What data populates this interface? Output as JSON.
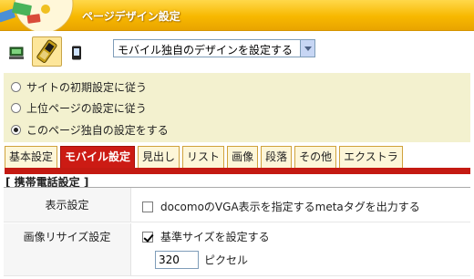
{
  "header": {
    "title": "ページデザイン設定"
  },
  "device_bar": {
    "icons": [
      "pc-icon",
      "mobile-device-icon",
      "smartphone-icon"
    ],
    "selected_device": "mobile",
    "design_select": {
      "value": "モバイル独自のデザインを設定する"
    }
  },
  "inherit_options": [
    {
      "label": "サイトの初期設定に従う",
      "checked": false
    },
    {
      "label": "上位ページの設定に従う",
      "checked": false
    },
    {
      "label": "このページ独自の設定をする",
      "checked": true
    }
  ],
  "tabs": [
    {
      "label": "基本設定",
      "active": false
    },
    {
      "label": "モバイル設定",
      "active": true
    },
    {
      "label": "見出し",
      "active": false
    },
    {
      "label": "リスト",
      "active": false
    },
    {
      "label": "画像",
      "active": false
    },
    {
      "label": "段落",
      "active": false
    },
    {
      "label": "その他",
      "active": false
    },
    {
      "label": "エクストラ",
      "active": false
    }
  ],
  "section": {
    "title": "[ 携帯電話設定 ]",
    "rows": {
      "display": {
        "label": "表示設定",
        "option": {
          "text": "docomoのVGA表示を指定するmetaタグを出力する",
          "checked": false
        }
      },
      "image_resize": {
        "label": "画像リサイズ設定",
        "option": {
          "text": "基準サイズを設定する",
          "checked": true
        },
        "size_value": "320",
        "unit": "ピクセル"
      }
    }
  },
  "colors": {
    "header": "#f7b800",
    "active_tab": "#cc1b14",
    "radio_panel": "#f3f1cf"
  }
}
